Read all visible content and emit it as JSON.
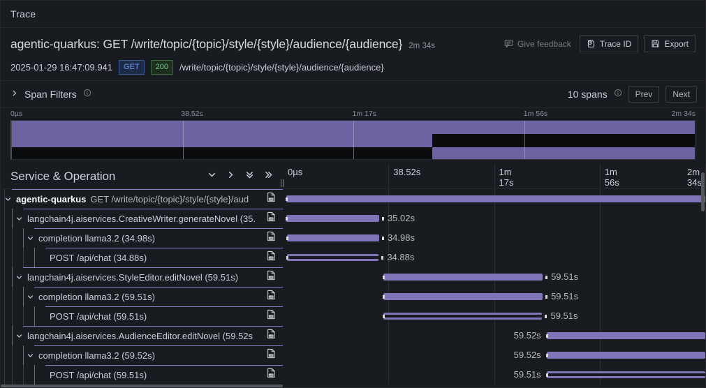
{
  "window": {
    "title": "Trace"
  },
  "header": {
    "trace_name": "agentic-quarkus: GET /write/topic/{topic}/style/{style}/audience/{audience}",
    "duration": "2m 34s",
    "feedback_label": "Give feedback",
    "trace_id_label": "Trace ID",
    "export_label": "Export",
    "timestamp": "2025-01-29 16:47:09.941",
    "method": "GET",
    "status": "200",
    "url": "/write/topic/{topic}/style/{style}/audience/{audience}"
  },
  "filters": {
    "label": "Span Filters",
    "spans_count": "10 spans",
    "prev_label": "Prev",
    "next_label": "Next"
  },
  "minimap": {
    "ticks": [
      "0µs",
      "38.52s",
      "1m 17s",
      "1m 56s",
      "2m 34s"
    ],
    "tick_positions": [
      0,
      25,
      50,
      75,
      100
    ],
    "rows": [
      {
        "start": 0,
        "end": 100
      },
      {
        "start": 0,
        "end": 22.7
      },
      {
        "start": 22.7,
        "end": 61.6
      },
      {
        "start": 61.6,
        "end": 100
      }
    ]
  },
  "columns": {
    "left_title": "Service & Operation",
    "ticks": [
      "0µs",
      "38.52s",
      "1m\n17s",
      "1m\n56s",
      "2m\n34s"
    ],
    "tick_positions": [
      0,
      25,
      50,
      75,
      100
    ]
  },
  "spans": [
    {
      "depth": 0,
      "caret": "down",
      "service": "agentic-quarkus",
      "operation": "GET /write/topic/{topic}/style/{style}/aud",
      "duration": "",
      "bar_start": 0.0,
      "bar_end": 100.0,
      "hollow": false,
      "label_side": "none"
    },
    {
      "depth": 1,
      "caret": "down",
      "service": "",
      "operation": "langchain4j.aiservices.CreativeWriter.generateNovel (35.",
      "duration": "35.02s",
      "bar_start": 0.0,
      "bar_end": 22.8,
      "hollow": false,
      "label_side": "right"
    },
    {
      "depth": 2,
      "caret": "down",
      "service": "",
      "operation": "completion llama3.2 (34.98s)",
      "duration": "34.98s",
      "bar_start": 0.1,
      "bar_end": 22.8,
      "hollow": false,
      "label_side": "right"
    },
    {
      "depth": 3,
      "caret": "none",
      "service": "",
      "operation": "POST /api/chat (34.88s)",
      "duration": "34.88s",
      "bar_start": 0.1,
      "bar_end": 22.7,
      "hollow": true,
      "label_side": "right"
    },
    {
      "depth": 1,
      "caret": "down",
      "service": "",
      "operation": "langchain4j.aiservices.StyleEditor.editNovel (59.51s)",
      "duration": "59.51s",
      "bar_start": 22.9,
      "bar_end": 61.5,
      "hollow": false,
      "label_side": "right"
    },
    {
      "depth": 2,
      "caret": "down",
      "service": "",
      "operation": "completion llama3.2 (59.51s)",
      "duration": "59.51s",
      "bar_start": 22.9,
      "bar_end": 61.5,
      "hollow": false,
      "label_side": "right"
    },
    {
      "depth": 3,
      "caret": "none",
      "service": "",
      "operation": "POST /api/chat (59.51s)",
      "duration": "59.51s",
      "bar_start": 22.9,
      "bar_end": 61.4,
      "hollow": true,
      "label_side": "right"
    },
    {
      "depth": 1,
      "caret": "down",
      "service": "",
      "operation": "langchain4j.aiservices.AudienceEditor.editNovel (59.52s",
      "duration": "59.52s",
      "bar_start": 61.6,
      "bar_end": 100.0,
      "hollow": false,
      "label_side": "left"
    },
    {
      "depth": 2,
      "caret": "down",
      "service": "",
      "operation": "completion llama3.2 (59.52s)",
      "duration": "59.52s",
      "bar_start": 61.6,
      "bar_end": 100.0,
      "hollow": false,
      "label_side": "left"
    },
    {
      "depth": 3,
      "caret": "none",
      "service": "",
      "operation": "POST /api/chat (59.51s)",
      "duration": "59.51s",
      "bar_start": 61.6,
      "bar_end": 100.0,
      "hollow": true,
      "label_side": "left"
    }
  ],
  "icons": {
    "feedback": "comment-icon",
    "trace_id": "clipboard-clock-icon",
    "export": "save-icon",
    "info": "info-circle-icon",
    "collapse_one": "chevron-down-icon",
    "expand_one": "chevron-right-icon",
    "collapse_all": "double-chevron-down-icon",
    "expand_all": "double-chevron-right-icon",
    "log": "log-document-icon"
  },
  "colors": {
    "bar": "#8075b8",
    "minimap_bar": "#6d63a3",
    "accent_line": "#8b7fc4",
    "background": "#181b1f",
    "method_badge": "#6e9fff",
    "status_badge": "#6ccf8e"
  }
}
